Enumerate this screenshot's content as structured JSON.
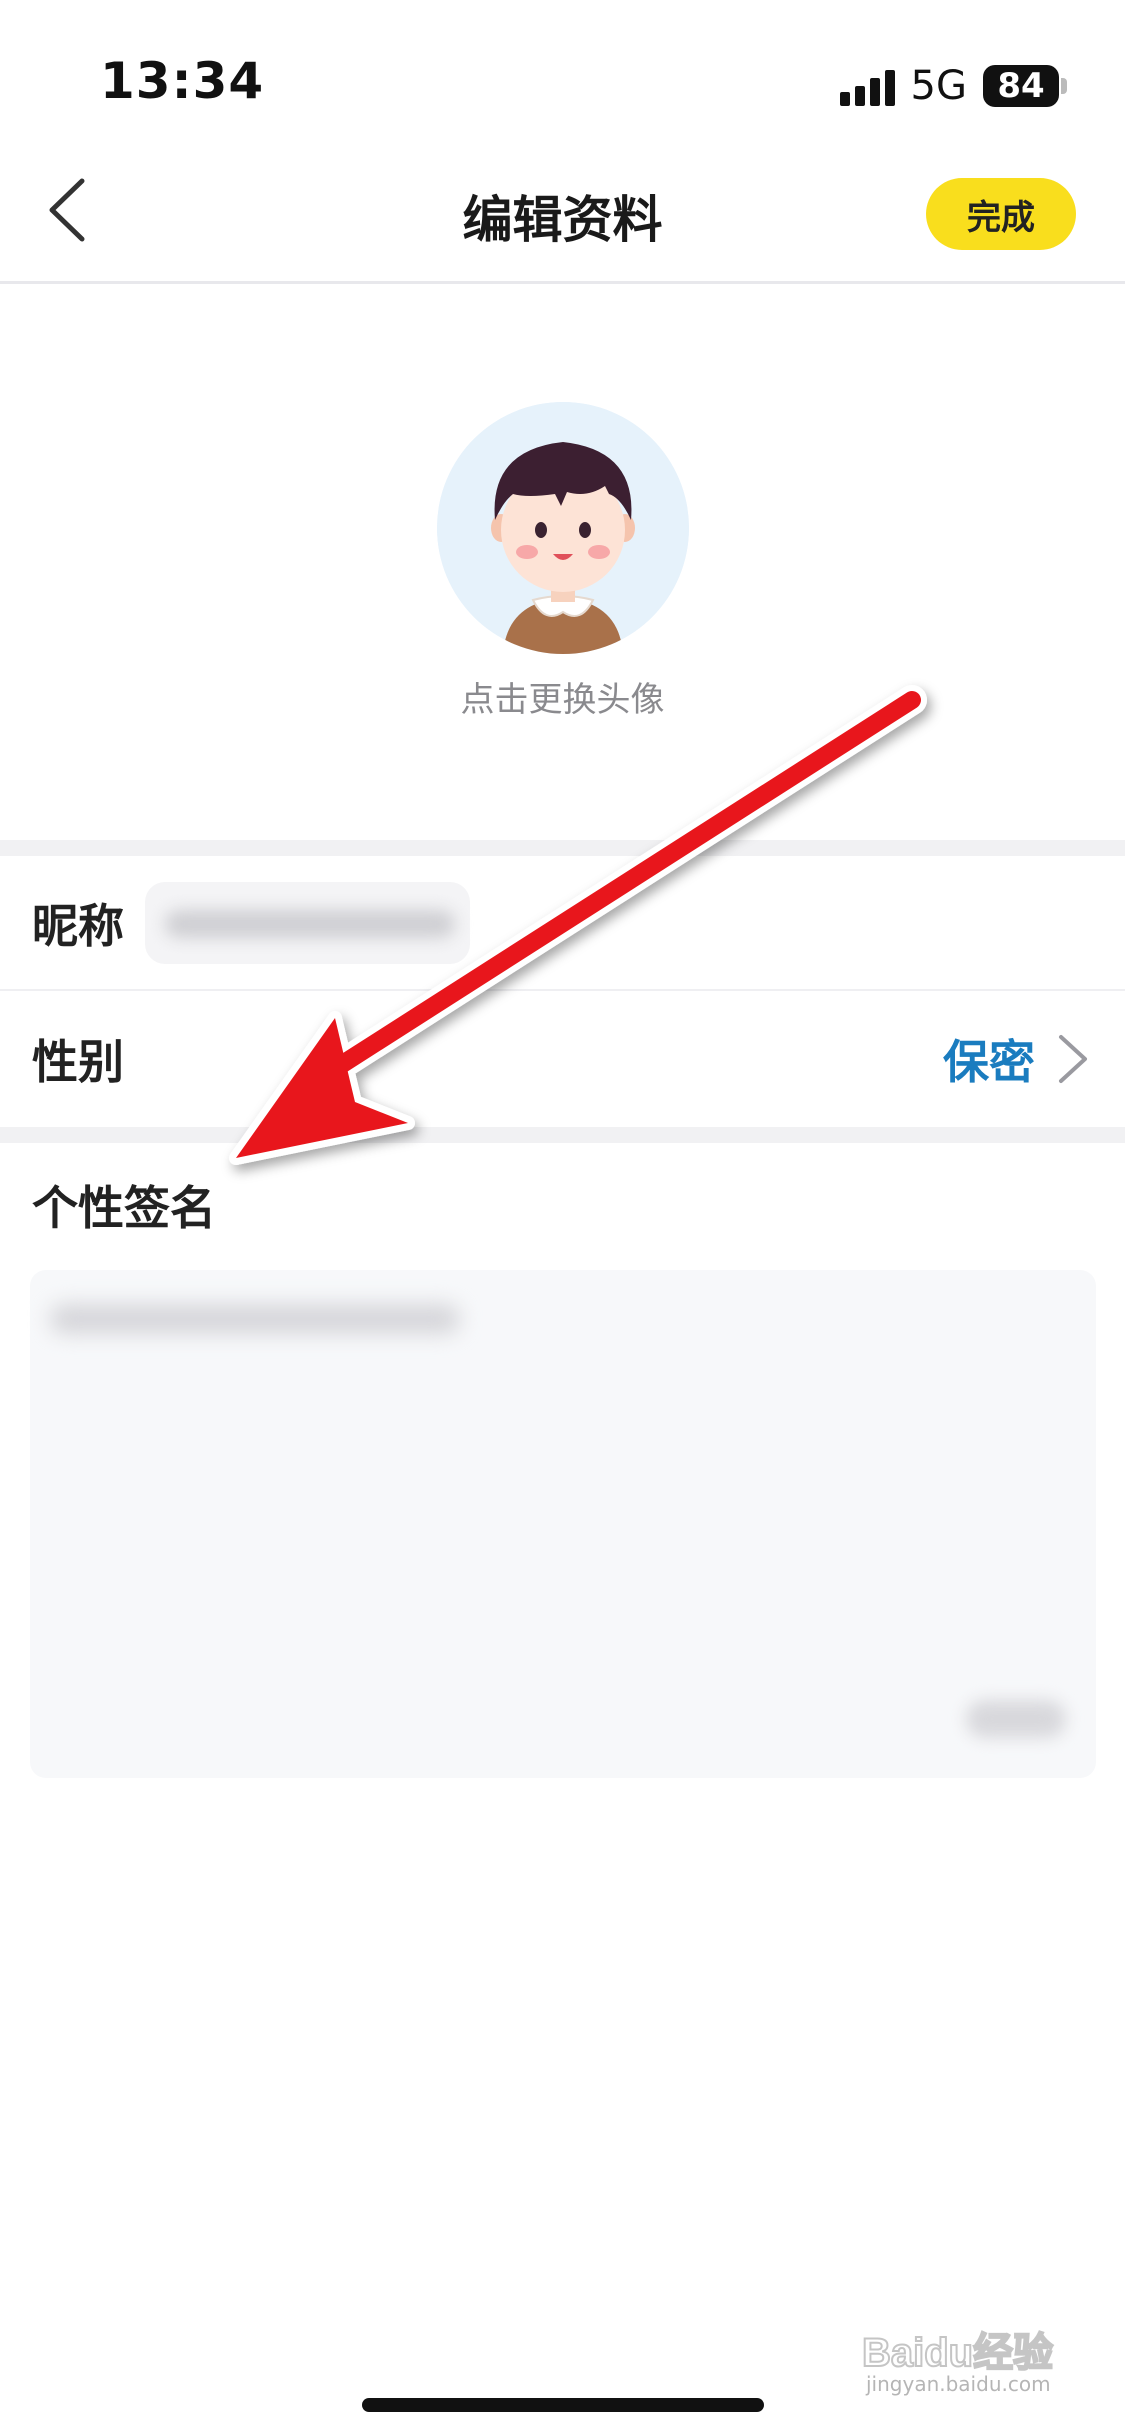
{
  "status_bar": {
    "time": "13:34",
    "network": "5G",
    "battery": "84"
  },
  "header": {
    "title": "编辑资料",
    "done_label": "完成"
  },
  "avatar": {
    "hint": "点击更换头像"
  },
  "profile": {
    "nickname_label": "昵称",
    "gender_label": "性别",
    "gender_value": "保密",
    "signature_label": "个性签名"
  },
  "watermark": {
    "text": "Baidu经验",
    "sub": "jingyan.baidu.com"
  },
  "colors": {
    "accent_yellow": "#f9de1d",
    "link_blue": "#1a7cbf",
    "annotation_red": "#e8191c"
  }
}
